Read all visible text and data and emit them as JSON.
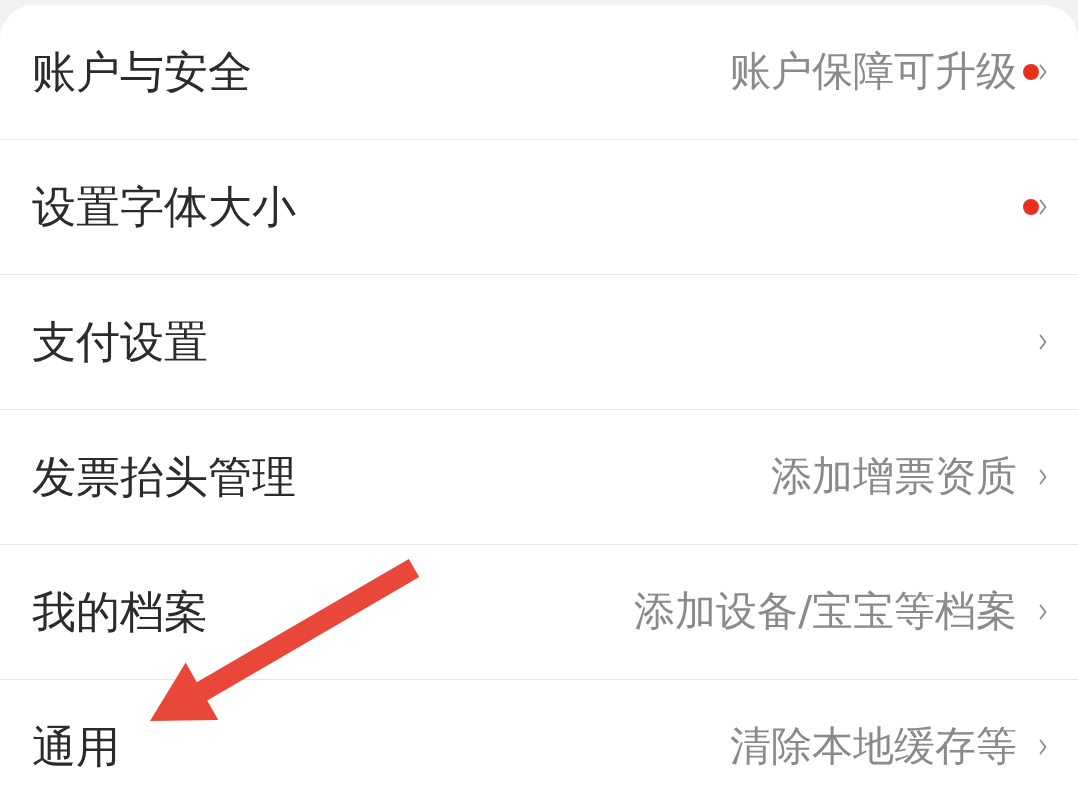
{
  "rows": [
    {
      "title": "账户与安全",
      "value": "账户保障可升级",
      "dot": true
    },
    {
      "title": "设置字体大小",
      "dot": true
    },
    {
      "title": "支付设置",
      "dot": false
    },
    {
      "title": "发票抬头管理",
      "value": "添加增票资质",
      "dot": false
    },
    {
      "title": "我的档案",
      "value": "添加设备/宝宝等档案",
      "dot": false
    },
    {
      "title": "通用",
      "value": "清除本地缓存等",
      "dot": false
    }
  ],
  "pointer_arrow": true
}
